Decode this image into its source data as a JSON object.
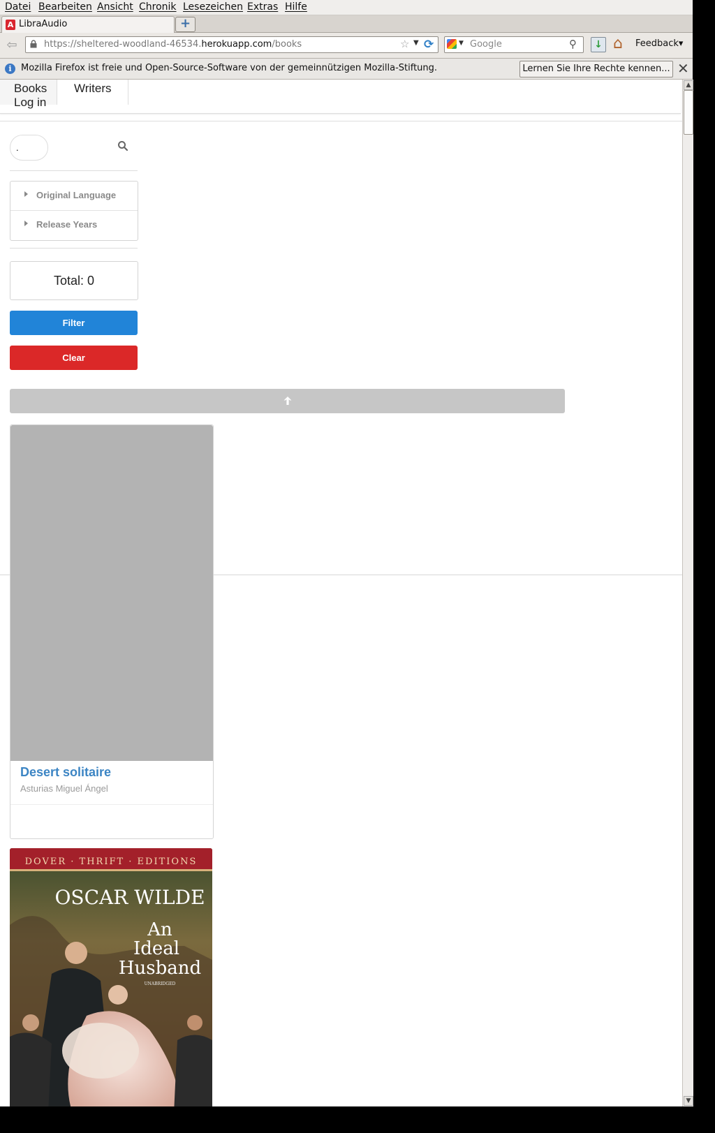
{
  "menu": [
    "Datei",
    "Bearbeiten",
    "Ansicht",
    "Chronik",
    "Lesezeichen",
    "Extras",
    "Hilfe"
  ],
  "tab": {
    "favicon": "A",
    "title": "LibraAudio"
  },
  "url": {
    "prefix": "https://sheltered-woodland-46534.",
    "domain": "herokuapp.com",
    "path": "/books"
  },
  "search": {
    "placeholder": "Google"
  },
  "toolbar": {
    "feedback": "Feedback"
  },
  "notification": {
    "text": "Mozilla Firefox ist freie und Open-Source-Software von der gemeinnützigen Mozilla-Stiftung.",
    "button": "Lernen Sie Ihre Rechte kennen..."
  },
  "nav": {
    "books": "Books",
    "writers": "Writers",
    "login": "Log in"
  },
  "sidebar": {
    "search_value": ".",
    "facets": [
      "Original Language",
      "Release Years"
    ],
    "total": "Total: 0",
    "filter": "Filter",
    "clear": "Clear"
  },
  "books": [
    {
      "title": "Desert solitaire",
      "author": "Asturias Miguel Ángel"
    },
    {
      "cover": {
        "series": "DOVER · THRIFT · EDITIONS",
        "author": "OSCAR WILDE",
        "title_1": "An",
        "title_2": "Ideal",
        "title_3": "Husband",
        "note": "UNABRIDGED"
      }
    }
  ],
  "colors": {
    "primary": "#2184d8",
    "danger": "#db2828",
    "link": "#3c85c4"
  }
}
